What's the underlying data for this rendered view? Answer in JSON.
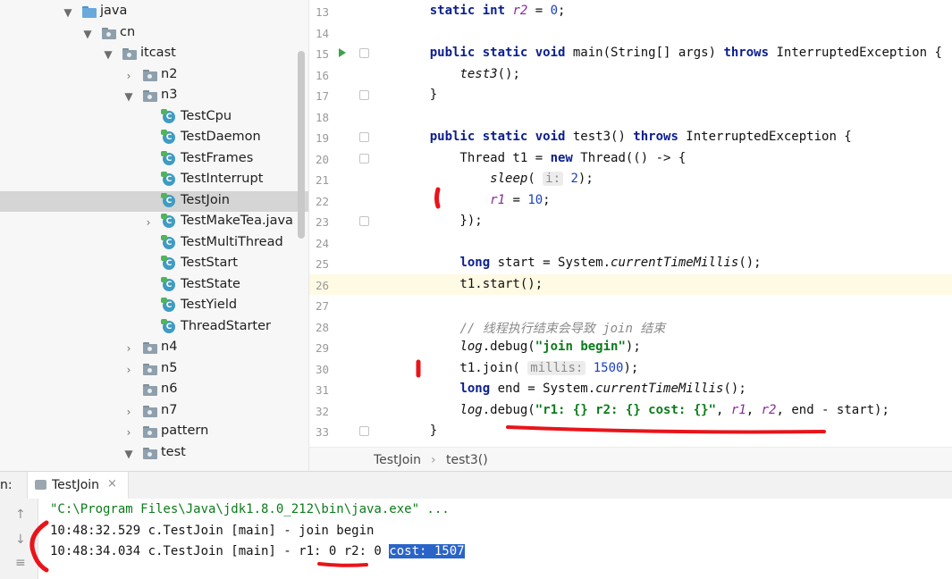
{
  "project_tree": {
    "items": [
      {
        "label": "java",
        "kind": "folder-blue",
        "arrow": "▼"
      },
      {
        "label": "cn",
        "kind": "package",
        "arrow": "▼"
      },
      {
        "label": "itcast",
        "kind": "package",
        "arrow": "▼"
      },
      {
        "label": "n2",
        "kind": "package",
        "arrow": "›"
      },
      {
        "label": "n3",
        "kind": "package",
        "arrow": "▼"
      },
      {
        "label": "TestCpu",
        "kind": "class"
      },
      {
        "label": "TestDaemon",
        "kind": "class"
      },
      {
        "label": "TestFrames",
        "kind": "class"
      },
      {
        "label": "TestInterrupt",
        "kind": "class"
      },
      {
        "label": "TestJoin",
        "kind": "class",
        "selected": true
      },
      {
        "label": "TestMakeTea.java",
        "kind": "class",
        "arrow": "›"
      },
      {
        "label": "TestMultiThread",
        "kind": "class"
      },
      {
        "label": "TestStart",
        "kind": "class"
      },
      {
        "label": "TestState",
        "kind": "class"
      },
      {
        "label": "TestYield",
        "kind": "class"
      },
      {
        "label": "ThreadStarter",
        "kind": "class"
      },
      {
        "label": "n4",
        "kind": "package",
        "arrow": "›"
      },
      {
        "label": "n5",
        "kind": "package",
        "arrow": "›"
      },
      {
        "label": "n6",
        "kind": "package"
      },
      {
        "label": "n7",
        "kind": "package",
        "arrow": "›"
      },
      {
        "label": "pattern",
        "kind": "package",
        "arrow": "›"
      },
      {
        "label": "test",
        "kind": "package",
        "arrow": "▼"
      }
    ]
  },
  "editor": {
    "current_line": "26",
    "lines": [
      {
        "n": "13",
        "html": "    <span class=\"kw\">static int</span> <span class=\"fld\">r2</span> = <span class=\"num\">0</span>;"
      },
      {
        "n": "14",
        "html": ""
      },
      {
        "n": "15",
        "run": true,
        "html": "    <span class=\"kw\">public static void</span> main(String[] args) <span class=\"kw\">throws</span> InterruptedException {"
      },
      {
        "n": "16",
        "html": "        <span class=\"it\">test3</span>();"
      },
      {
        "n": "17",
        "html": "    }"
      },
      {
        "n": "18",
        "html": ""
      },
      {
        "n": "19",
        "html": "    <span class=\"kw\">public static void</span> test3() <span class=\"kw\">throws</span> InterruptedException {"
      },
      {
        "n": "20",
        "html": "        Thread t1 = <span class=\"kw\">new</span> Thread(() -> {"
      },
      {
        "n": "21",
        "html": "            <span class=\"it\">sleep</span>( <span class=\"hint\">i:</span> <span class=\"num\">2</span>);"
      },
      {
        "n": "22",
        "html": "            <span class=\"fld\">r1</span> = <span class=\"num\">10</span>;"
      },
      {
        "n": "23",
        "html": "        });"
      },
      {
        "n": "24",
        "html": ""
      },
      {
        "n": "25",
        "html": "        <span class=\"kw\">long</span> start = System.<span class=\"it\">currentTimeMillis</span>();"
      },
      {
        "n": "26",
        "html": "        t1.start();"
      },
      {
        "n": "27",
        "html": ""
      },
      {
        "n": "28",
        "html": "        <span class=\"cmt\">// 线程执行结束会导致 join 结束</span>"
      },
      {
        "n": "29",
        "html": "        <span class=\"it\">log</span>.debug(<span class=\"str\">\"join begin\"</span>);"
      },
      {
        "n": "30",
        "html": "        t1.join( <span class=\"hint\">millis:</span> <span class=\"num\">1500</span>);"
      },
      {
        "n": "31",
        "html": "        <span class=\"kw\">long</span> end = System.<span class=\"it\">currentTimeMillis</span>();"
      },
      {
        "n": "32",
        "html": "        <span class=\"it\">log</span>.debug(<span class=\"str\">\"r1: {} r2: {} cost: {}\"</span>, <span class=\"fld\">r1</span>, <span class=\"fld\">r2</span>, end - start);"
      },
      {
        "n": "33",
        "html": "    }"
      }
    ]
  },
  "breadcrumbs": {
    "class": "TestJoin",
    "separator": "›",
    "method": "test3()"
  },
  "run_panel": {
    "prefix": "n:",
    "tab_label": "TestJoin",
    "close": "×",
    "command": "\"C:\\Program Files\\Java\\jdk1.8.0_212\\bin\\java.exe\" ...",
    "log1": "10:48:32.529 c.TestJoin [main] - join begin",
    "log2_prefix": "10:48:34.034 c.TestJoin [main] - r1: 0 r2: 0 ",
    "log2_selected": "cost: 1507"
  },
  "colors": {
    "annotation": "#e8141a",
    "selection": "#2a64c8",
    "current_line": "#fffae3"
  }
}
